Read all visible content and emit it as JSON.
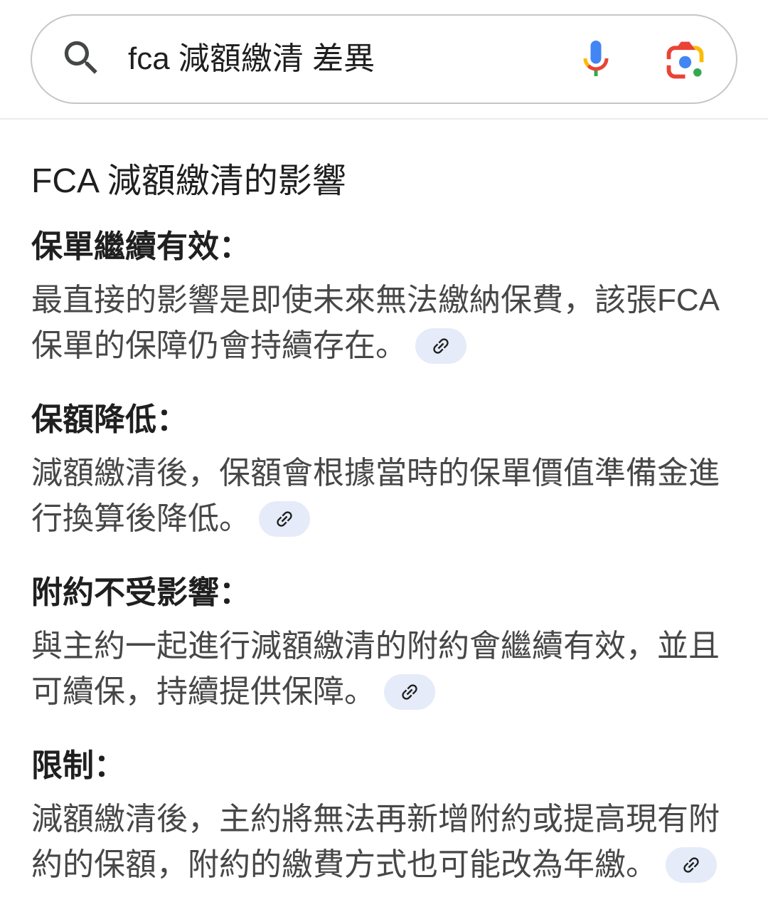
{
  "search": {
    "query": "fca 減額繳清 差異"
  },
  "overview": {
    "heading": "FCA 減額繳清的影響",
    "sections": [
      {
        "title": "保單繼續有效：",
        "lines": [
          "最直接的影響是即使未來無法繳納保費，該張FCA",
          "保單的保障仍會持續存在。"
        ]
      },
      {
        "title": "保額降低：",
        "lines": [
          "減額繳清後，保額會根據當時的保單價值準備金進",
          "行換算後降低。"
        ]
      },
      {
        "title": "附約不受影響：",
        "lines": [
          "與主約一起進行減額繳清的附約會繼續有效，並且",
          "可續保，持續提供保障。"
        ]
      },
      {
        "title": "限制：",
        "lines": [
          "減額繳清後，主約將無法再新增附約或提高現有附",
          "約的保額，附約的繳費方式也可能改為年繳。"
        ]
      }
    ]
  },
  "icons": {
    "search": "search-icon",
    "voice": "mic-icon",
    "lens": "lens-icon",
    "source_link": "link-icon"
  },
  "colors": {
    "text_primary": "#1f1f1f",
    "text_secondary": "#474747",
    "chip_background": "#e5ebf8",
    "google_blue": "#4285f4",
    "google_red": "#ea4335",
    "google_yellow": "#fbbc04",
    "google_green": "#34a853"
  }
}
